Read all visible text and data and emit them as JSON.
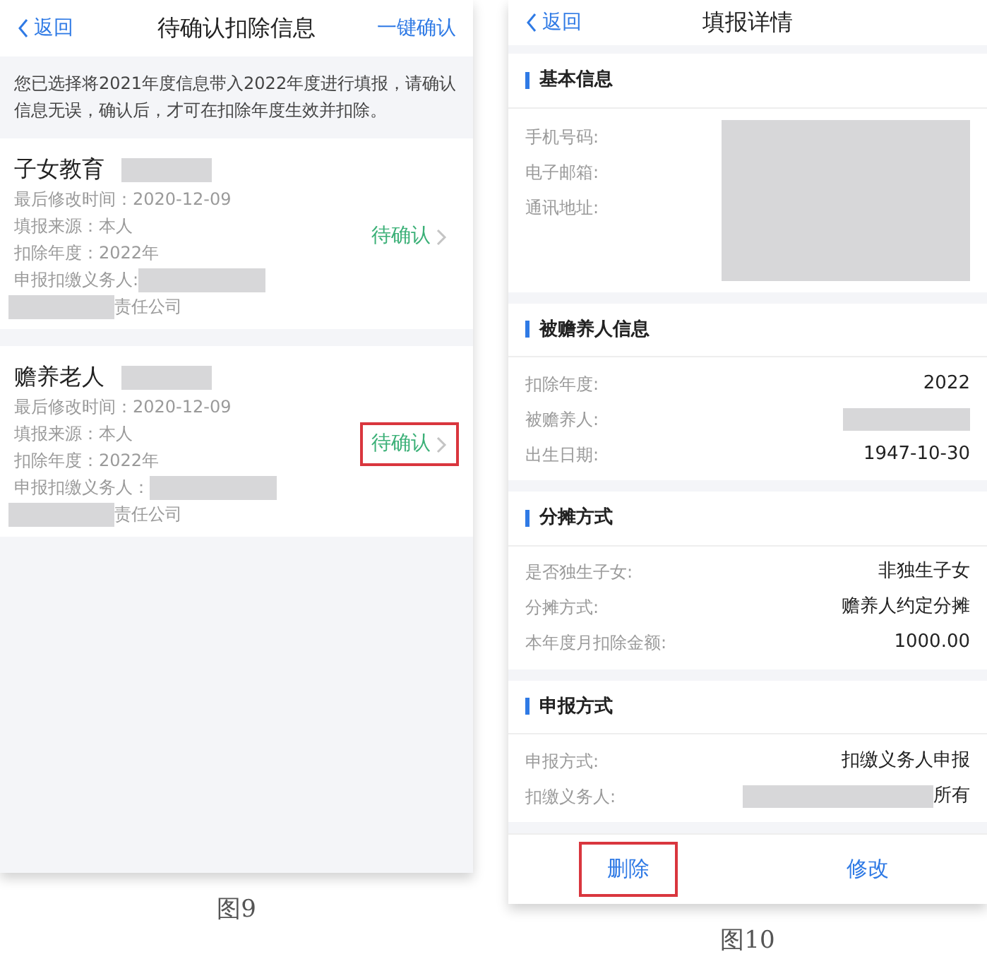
{
  "left_screen": {
    "nav": {
      "back": "返回",
      "title": "待确认扣除信息",
      "action": "一键确认"
    },
    "notice": "您已选择将2021年度信息带入2022年度进行填报，请确认信息无误，确认后，才可在扣除年度生效并扣除。",
    "items": [
      {
        "title": "子女教育",
        "title_redacted": true,
        "lines": [
          {
            "text": "最后修改时间：2020-12-09"
          },
          {
            "text": "填报来源：本人"
          },
          {
            "text": "扣除年度：2022年"
          },
          {
            "text": "申报扣缴义务人:",
            "mask_after": true
          },
          {
            "text": "责任公司",
            "mask_before": true
          }
        ],
        "status": {
          "text": "待确认",
          "highlighted": false
        }
      },
      {
        "title": "赡养老人",
        "title_redacted": true,
        "lines": [
          {
            "text": "最后修改时间：2020-12-09"
          },
          {
            "text": "填报来源：本人"
          },
          {
            "text": "扣除年度：2022年"
          },
          {
            "text": "申报扣缴义务人：",
            "mask_after": true
          },
          {
            "text": "责任公司",
            "mask_before": true
          }
        ],
        "status": {
          "text": "待确认",
          "highlighted": true
        }
      }
    ]
  },
  "right_screen": {
    "nav": {
      "back": "返回",
      "title": "填报详情"
    },
    "sections": [
      {
        "title": "基本信息",
        "kind": "redacted-block",
        "rows": [
          {
            "label": "手机号码:"
          },
          {
            "label": "电子邮箱:"
          },
          {
            "label": "通讯地址:"
          }
        ]
      },
      {
        "title": "被赡养人信息",
        "kind": "rows",
        "rows": [
          {
            "label": "扣除年度:",
            "value": "2022"
          },
          {
            "label": "被赡养人:",
            "mask_before": true
          },
          {
            "label": "出生日期:",
            "value": "1947-10-30"
          }
        ]
      },
      {
        "title": "分摊方式",
        "kind": "rows",
        "rows": [
          {
            "label": "是否独生子女:",
            "value": "非独生子女"
          },
          {
            "label": "分摊方式:",
            "value": "赡养人约定分摊"
          },
          {
            "label": "本年度月扣除金额:",
            "value": "1000.00"
          }
        ]
      },
      {
        "title": "申报方式",
        "kind": "rows",
        "rows": [
          {
            "label": "申报方式:",
            "value": "扣缴义务人申报"
          },
          {
            "label": "扣缴义务人:",
            "value": "所有",
            "mask_before": true
          }
        ]
      }
    ],
    "bottom_buttons": [
      {
        "text": "删除",
        "highlighted": true
      },
      {
        "text": "修改",
        "highlighted": false
      }
    ]
  },
  "captions": [
    "图9",
    "图10"
  ]
}
